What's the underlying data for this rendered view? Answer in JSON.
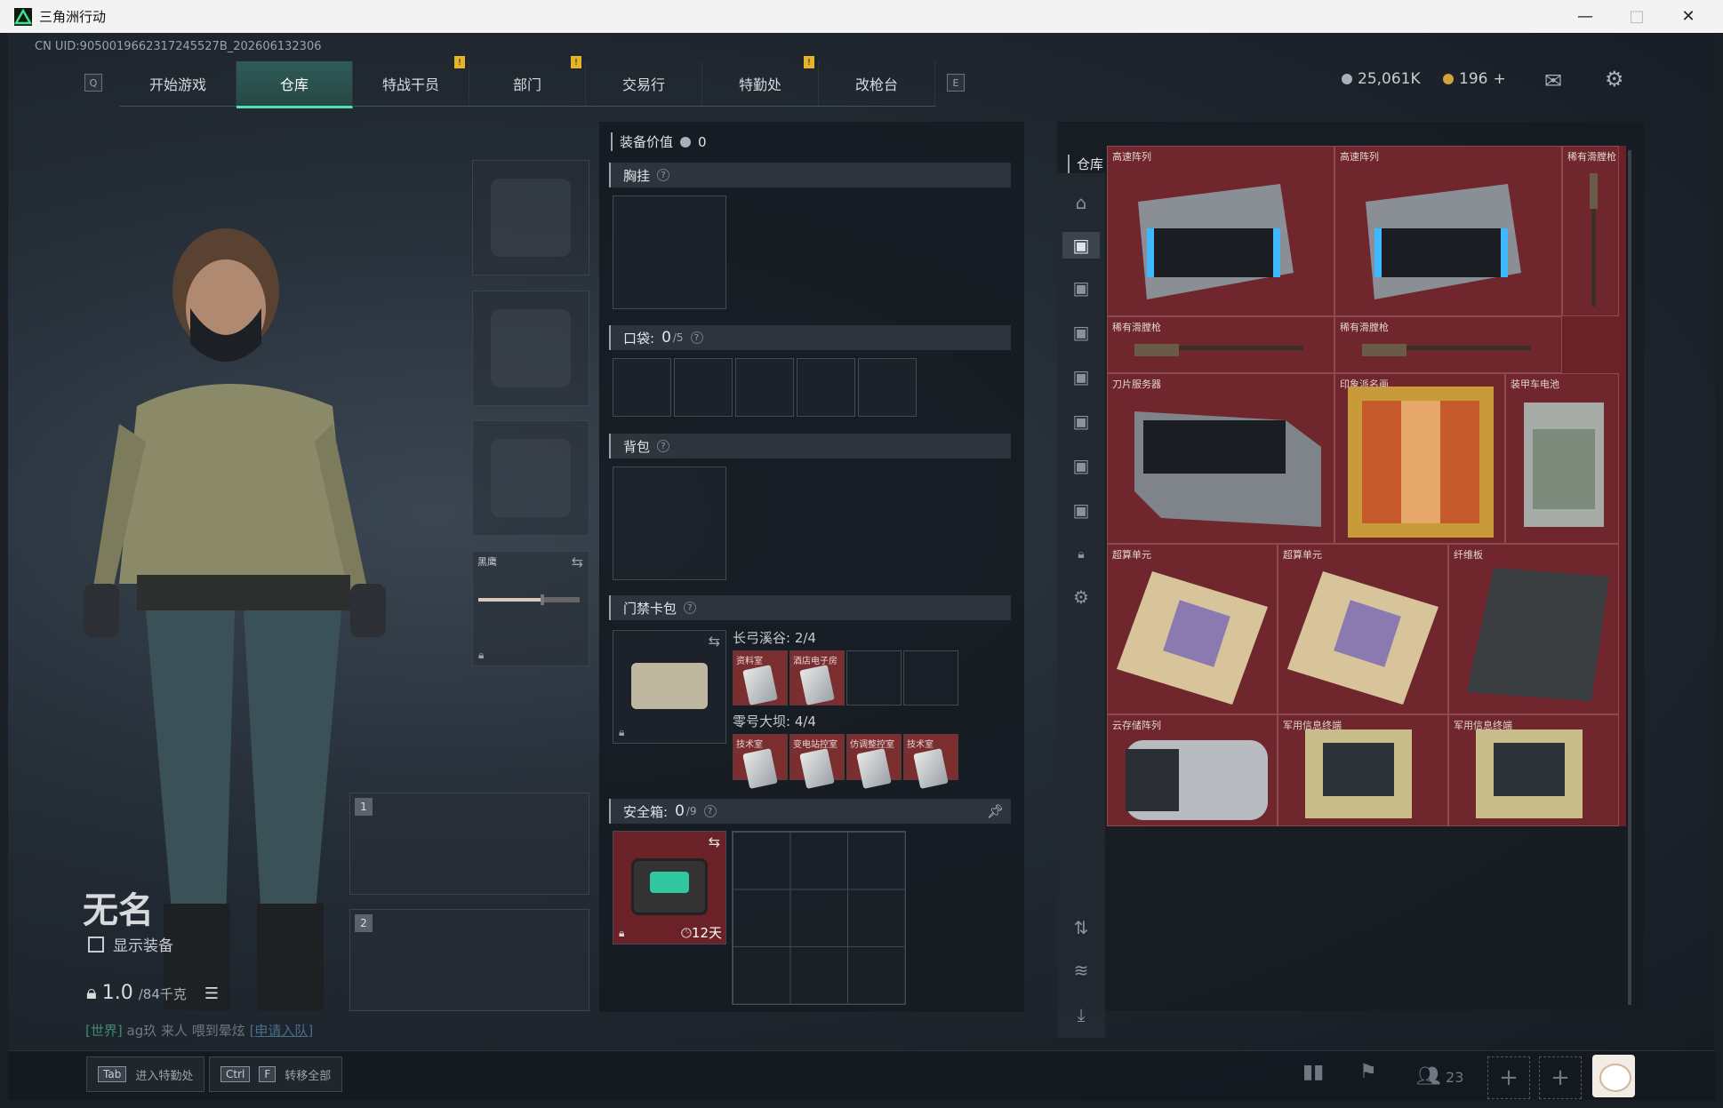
{
  "window": {
    "title": "三角洲行动"
  },
  "uid": "CN UID:9050019662317245527B_202606132306",
  "nav": {
    "key_left": "Q",
    "key_right": "E",
    "tabs": [
      {
        "label": "开始游戏",
        "active": false,
        "alert": false
      },
      {
        "label": "仓库",
        "active": true,
        "alert": false
      },
      {
        "label": "特战干员",
        "active": false,
        "alert": true
      },
      {
        "label": "部门",
        "active": false,
        "alert": true
      },
      {
        "label": "交易行",
        "active": false,
        "alert": false
      },
      {
        "label": "特勤处",
        "active": false,
        "alert": true
      },
      {
        "label": "改枪台",
        "active": false,
        "alert": false
      }
    ],
    "alert_symbol": "!"
  },
  "currency": {
    "silver": "25,061K",
    "gold": "196",
    "gold_add": "+"
  },
  "player": {
    "name": "无名",
    "show_equipment": "显示装备",
    "weight": "1.0",
    "weight_max": "/84千克"
  },
  "chat": {
    "channel": "[世界]",
    "sender": "ag玖",
    "text": "来人  喂到晕炫",
    "join": "[申请入队]"
  },
  "equipment": {
    "melee_label": "黑鹰",
    "weapon_slot_1": "1",
    "weapon_slot_2": "2"
  },
  "loadout": {
    "value_label": "装备价值",
    "value": "0",
    "chest_label": "胸挂",
    "pockets_label": "口袋:",
    "pockets_count": "0",
    "pockets_max": "/5",
    "backpack_label": "背包",
    "keycard_label": "门禁卡包",
    "map1": "长弓溪谷: 2/4",
    "map1_cards": [
      "资料室",
      "酒店电子房"
    ],
    "map2": "零号大坝: 4/4",
    "map2_cards": [
      "技术室",
      "变电站控室",
      "仿调整控室",
      "技术室"
    ],
    "safe_label": "安全箱:",
    "safe_count": "0",
    "safe_max": "/9",
    "safe_timer": "12天",
    "help": "?"
  },
  "warehouse": {
    "title": "仓库",
    "items": [
      {
        "name": "高速阵列",
        "kind": "server"
      },
      {
        "name": "高速阵列",
        "kind": "server"
      },
      {
        "name": "稀有滑膛枪",
        "kind": "musket-v"
      },
      {
        "name": "稀有滑膛枪",
        "kind": "musket"
      },
      {
        "name": "稀有滑膛枪",
        "kind": "musket"
      },
      {
        "name": "刀片服务器",
        "kind": "blade"
      },
      {
        "name": "印象派名画",
        "kind": "painting"
      },
      {
        "name": "装甲车电池",
        "kind": "battery"
      },
      {
        "name": "超算单元",
        "kind": "chip"
      },
      {
        "name": "超算单元",
        "kind": "chip"
      },
      {
        "name": "纤维板",
        "kind": "board"
      },
      {
        "name": "云存储阵列",
        "kind": "cloud"
      },
      {
        "name": "军用信息终端",
        "kind": "terminal"
      },
      {
        "name": "军用信息终端",
        "kind": "terminal"
      }
    ]
  },
  "bottom": {
    "tab_key": "Tab",
    "tab_label": "进入特勤处",
    "ctrl_key": "Ctrl",
    "f_key": "F",
    "transfer_label": "转移全部",
    "friends_count": "23",
    "plus": "+"
  },
  "colors": {
    "accent": "#4fe0b6",
    "item_bg": "#6f262c",
    "alert": "#e6b428"
  }
}
